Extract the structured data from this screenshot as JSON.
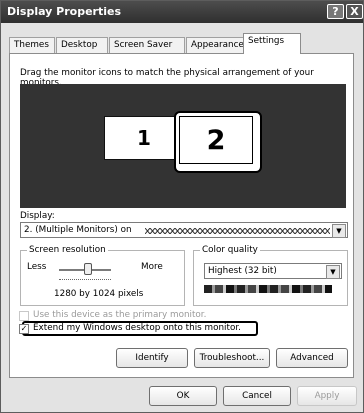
{
  "window": {
    "title": "Display Properties",
    "help_glyph": "?",
    "close_glyph": "X"
  },
  "tabs": [
    {
      "label": "Themes"
    },
    {
      "label": "Desktop"
    },
    {
      "label": "Screen Saver"
    },
    {
      "label": "Appearance"
    },
    {
      "label": "Settings",
      "active": true
    }
  ],
  "settings": {
    "instruction": "Drag the monitor icons to match the physical arrangement of your monitors.",
    "monitor_1": "1",
    "monitor_2": "2",
    "display_label": "Display:",
    "display_value": "2. (Multiple Monitors) on",
    "resolution": {
      "group_title": "Screen resolution",
      "less": "Less",
      "more": "More",
      "value": "1280 by 1024 pixels"
    },
    "color_quality": {
      "group_title": "Color quality",
      "value": "Highest (32 bit)"
    },
    "primary_checkbox": "Use this device as the primary monitor.",
    "extend_checkbox": "Extend my Windows desktop onto this monitor.",
    "buttons": {
      "identify": "Identify",
      "troubleshoot": "Troubleshoot...",
      "advanced": "Advanced"
    }
  },
  "dialog_buttons": {
    "ok": "OK",
    "cancel": "Cancel",
    "apply": "Apply"
  },
  "icons": {
    "dropdown": "chevron-down-icon",
    "checkmark": "checkmark-icon"
  }
}
